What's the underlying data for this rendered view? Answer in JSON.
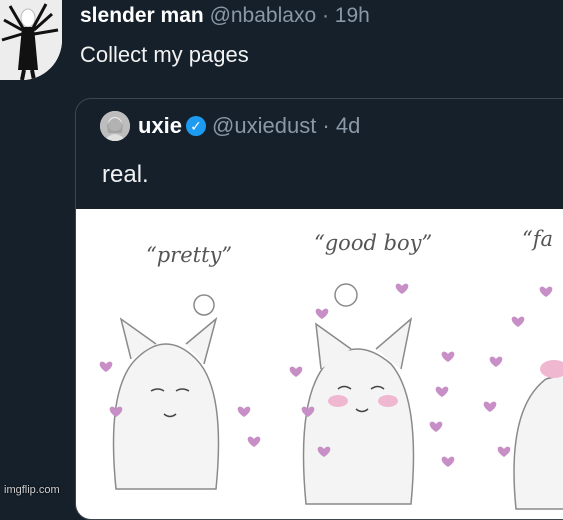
{
  "tweet": {
    "author_name": "slender man",
    "author_handle": "@nbablaxo",
    "separator": " · ",
    "time": "19h",
    "text": "Collect my pages"
  },
  "quoted_tweet": {
    "author_name": "uxie",
    "verified": true,
    "author_handle": "@uxiedust",
    "separator": " · ",
    "time": "4d",
    "text": "real.",
    "image": {
      "panels": [
        {
          "caption": "“pretty”"
        },
        {
          "caption": "“good boy”"
        },
        {
          "caption": "“fa"
        }
      ]
    }
  },
  "watermark": "imgflip.com",
  "colors": {
    "background": "#15202b",
    "verified_badge": "#1d9bf0",
    "muted_text": "#8b98a5",
    "hearts": "#c78fc6",
    "blush": "#f0b8d0"
  }
}
